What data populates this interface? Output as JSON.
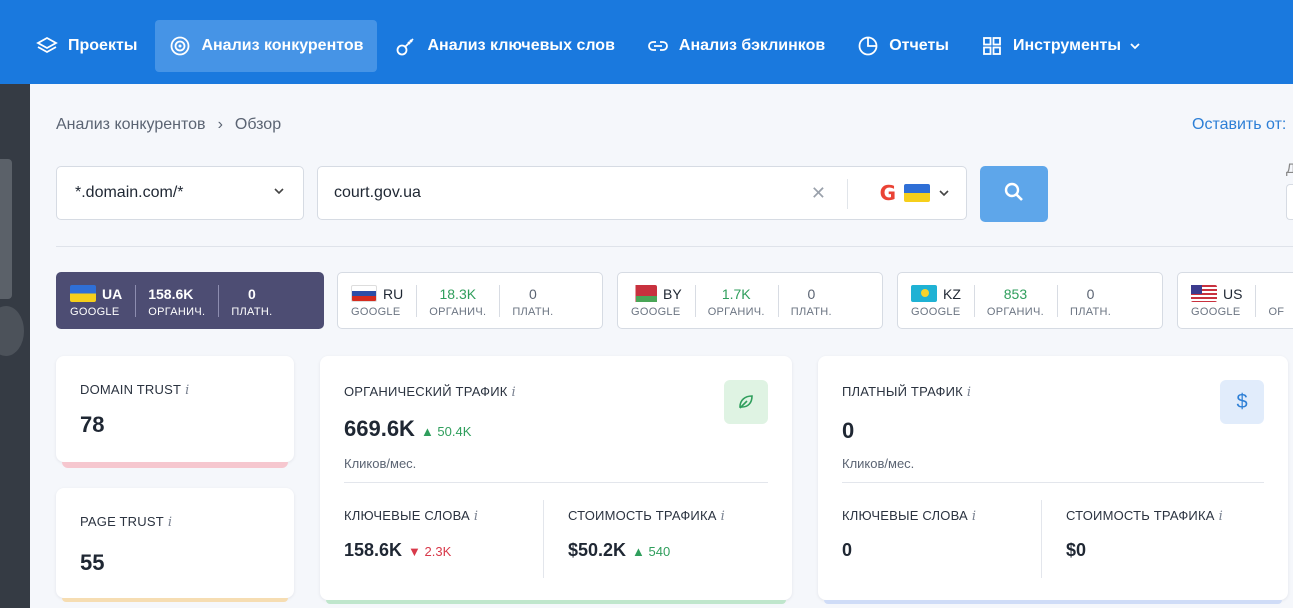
{
  "nav": {
    "items": [
      {
        "label": "Проекты",
        "icon": "layers-icon"
      },
      {
        "label": "Анализ конкурентов",
        "icon": "target-icon",
        "active": true
      },
      {
        "label": "Анализ ключевых слов",
        "icon": "key-icon"
      },
      {
        "label": "Анализ бэклинков",
        "icon": "link-icon"
      },
      {
        "label": "Отчеты",
        "icon": "pie-chart-icon"
      },
      {
        "label": "Инструменты",
        "icon": "grid-icon",
        "dropdown": true
      }
    ]
  },
  "breadcrumb": {
    "parent": "Анализ конкурентов",
    "separator": "›",
    "current": "Обзор"
  },
  "feedback_link": "Оставить от:",
  "cut_label": "Д",
  "search": {
    "mode_value": "*.domain.com/*",
    "query": "court.gov.ua",
    "engine": "G",
    "country": "UA"
  },
  "regions": [
    {
      "code": "UA",
      "engine": "GOOGLE",
      "organic": "158.6K",
      "organic_label": "ОРГАНИЧ.",
      "paid": "0",
      "paid_label": "ПЛАТН.",
      "active": true,
      "flag": "ua"
    },
    {
      "code": "RU",
      "engine": "GOOGLE",
      "organic": "18.3K",
      "organic_label": "ОРГАНИЧ.",
      "paid": "0",
      "paid_label": "ПЛАТН.",
      "flag": "ru"
    },
    {
      "code": "BY",
      "engine": "GOOGLE",
      "organic": "1.7K",
      "organic_label": "ОРГАНИЧ.",
      "paid": "0",
      "paid_label": "ПЛАТН.",
      "flag": "by"
    },
    {
      "code": "KZ",
      "engine": "GOOGLE",
      "organic": "853",
      "organic_label": "ОРГАНИЧ.",
      "paid": "0",
      "paid_label": "ПЛАТН.",
      "flag": "kz"
    },
    {
      "code": "US",
      "engine": "GOOGLE",
      "organic_label": "OF",
      "flag": "us"
    }
  ],
  "domain_trust": {
    "title": "DOMAIN TRUST",
    "info": "i",
    "value": "78"
  },
  "page_trust": {
    "title": "PAGE TRUST",
    "info": "i",
    "value": "55"
  },
  "organic": {
    "title": "ОРГАНИЧЕСКИЙ ТРАФИК",
    "info": "i",
    "value": "669.6K",
    "delta": "▲ 50.4K",
    "unit": "Кликов/мес.",
    "kw_title": "КЛЮЧЕВЫЕ СЛОВА",
    "kw_value": "158.6K",
    "kw_delta": "▼ 2.3K",
    "cost_title": "СТОИМОСТЬ ТРАФИКА",
    "cost_value": "$50.2K",
    "cost_delta": "▲ 540"
  },
  "paid": {
    "title": "ПЛАТНЫЙ ТРАФИК",
    "info": "i",
    "value": "0",
    "unit": "Кликов/мес.",
    "kw_title": "КЛЮЧЕВЫЕ СЛОВА",
    "kw_value": "0",
    "cost_title": "СТОИМОСТЬ ТРАФИКА",
    "cost_value": "$0",
    "icon_label": "$"
  },
  "colors": {
    "nav_bg": "#1a79de",
    "accent": "#2d7fd6",
    "active_region": "#4d4d73",
    "up": "#2f9e5c",
    "down": "#d8394a"
  }
}
